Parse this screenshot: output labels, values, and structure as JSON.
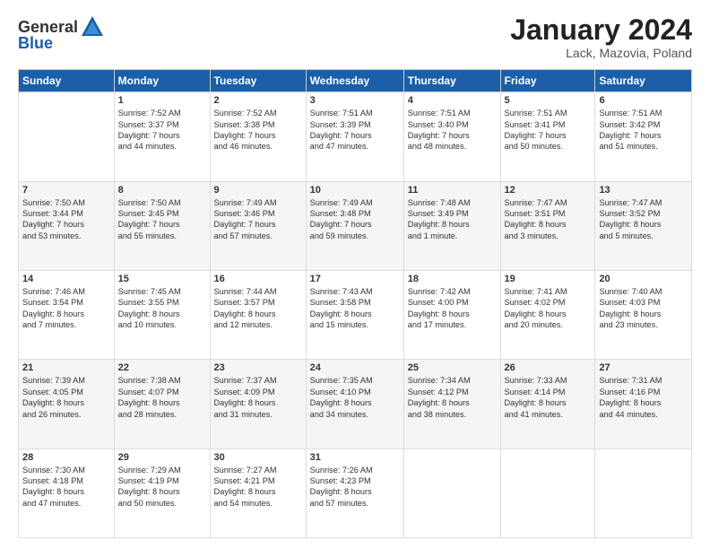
{
  "header": {
    "logo_general": "General",
    "logo_blue": "Blue",
    "title": "January 2024",
    "location": "Lack, Mazovia, Poland"
  },
  "weekdays": [
    "Sunday",
    "Monday",
    "Tuesday",
    "Wednesday",
    "Thursday",
    "Friday",
    "Saturday"
  ],
  "weeks": [
    [
      {
        "day": "",
        "content": ""
      },
      {
        "day": "1",
        "content": "Sunrise: 7:52 AM\nSunset: 3:37 PM\nDaylight: 7 hours\nand 44 minutes."
      },
      {
        "day": "2",
        "content": "Sunrise: 7:52 AM\nSunset: 3:38 PM\nDaylight: 7 hours\nand 46 minutes."
      },
      {
        "day": "3",
        "content": "Sunrise: 7:51 AM\nSunset: 3:39 PM\nDaylight: 7 hours\nand 47 minutes."
      },
      {
        "day": "4",
        "content": "Sunrise: 7:51 AM\nSunset: 3:40 PM\nDaylight: 7 hours\nand 48 minutes."
      },
      {
        "day": "5",
        "content": "Sunrise: 7:51 AM\nSunset: 3:41 PM\nDaylight: 7 hours\nand 50 minutes."
      },
      {
        "day": "6",
        "content": "Sunrise: 7:51 AM\nSunset: 3:42 PM\nDaylight: 7 hours\nand 51 minutes."
      }
    ],
    [
      {
        "day": "7",
        "content": "Sunrise: 7:50 AM\nSunset: 3:44 PM\nDaylight: 7 hours\nand 53 minutes."
      },
      {
        "day": "8",
        "content": "Sunrise: 7:50 AM\nSunset: 3:45 PM\nDaylight: 7 hours\nand 55 minutes."
      },
      {
        "day": "9",
        "content": "Sunrise: 7:49 AM\nSunset: 3:46 PM\nDaylight: 7 hours\nand 57 minutes."
      },
      {
        "day": "10",
        "content": "Sunrise: 7:49 AM\nSunset: 3:48 PM\nDaylight: 7 hours\nand 59 minutes."
      },
      {
        "day": "11",
        "content": "Sunrise: 7:48 AM\nSunset: 3:49 PM\nDaylight: 8 hours\nand 1 minute."
      },
      {
        "day": "12",
        "content": "Sunrise: 7:47 AM\nSunset: 3:51 PM\nDaylight: 8 hours\nand 3 minutes."
      },
      {
        "day": "13",
        "content": "Sunrise: 7:47 AM\nSunset: 3:52 PM\nDaylight: 8 hours\nand 5 minutes."
      }
    ],
    [
      {
        "day": "14",
        "content": "Sunrise: 7:46 AM\nSunset: 3:54 PM\nDaylight: 8 hours\nand 7 minutes."
      },
      {
        "day": "15",
        "content": "Sunrise: 7:45 AM\nSunset: 3:55 PM\nDaylight: 8 hours\nand 10 minutes."
      },
      {
        "day": "16",
        "content": "Sunrise: 7:44 AM\nSunset: 3:57 PM\nDaylight: 8 hours\nand 12 minutes."
      },
      {
        "day": "17",
        "content": "Sunrise: 7:43 AM\nSunset: 3:58 PM\nDaylight: 8 hours\nand 15 minutes."
      },
      {
        "day": "18",
        "content": "Sunrise: 7:42 AM\nSunset: 4:00 PM\nDaylight: 8 hours\nand 17 minutes."
      },
      {
        "day": "19",
        "content": "Sunrise: 7:41 AM\nSunset: 4:02 PM\nDaylight: 8 hours\nand 20 minutes."
      },
      {
        "day": "20",
        "content": "Sunrise: 7:40 AM\nSunset: 4:03 PM\nDaylight: 8 hours\nand 23 minutes."
      }
    ],
    [
      {
        "day": "21",
        "content": "Sunrise: 7:39 AM\nSunset: 4:05 PM\nDaylight: 8 hours\nand 26 minutes."
      },
      {
        "day": "22",
        "content": "Sunrise: 7:38 AM\nSunset: 4:07 PM\nDaylight: 8 hours\nand 28 minutes."
      },
      {
        "day": "23",
        "content": "Sunrise: 7:37 AM\nSunset: 4:09 PM\nDaylight: 8 hours\nand 31 minutes."
      },
      {
        "day": "24",
        "content": "Sunrise: 7:35 AM\nSunset: 4:10 PM\nDaylight: 8 hours\nand 34 minutes."
      },
      {
        "day": "25",
        "content": "Sunrise: 7:34 AM\nSunset: 4:12 PM\nDaylight: 8 hours\nand 38 minutes."
      },
      {
        "day": "26",
        "content": "Sunrise: 7:33 AM\nSunset: 4:14 PM\nDaylight: 8 hours\nand 41 minutes."
      },
      {
        "day": "27",
        "content": "Sunrise: 7:31 AM\nSunset: 4:16 PM\nDaylight: 8 hours\nand 44 minutes."
      }
    ],
    [
      {
        "day": "28",
        "content": "Sunrise: 7:30 AM\nSunset: 4:18 PM\nDaylight: 8 hours\nand 47 minutes."
      },
      {
        "day": "29",
        "content": "Sunrise: 7:29 AM\nSunset: 4:19 PM\nDaylight: 8 hours\nand 50 minutes."
      },
      {
        "day": "30",
        "content": "Sunrise: 7:27 AM\nSunset: 4:21 PM\nDaylight: 8 hours\nand 54 minutes."
      },
      {
        "day": "31",
        "content": "Sunrise: 7:26 AM\nSunset: 4:23 PM\nDaylight: 8 hours\nand 57 minutes."
      },
      {
        "day": "",
        "content": ""
      },
      {
        "day": "",
        "content": ""
      },
      {
        "day": "",
        "content": ""
      }
    ]
  ]
}
